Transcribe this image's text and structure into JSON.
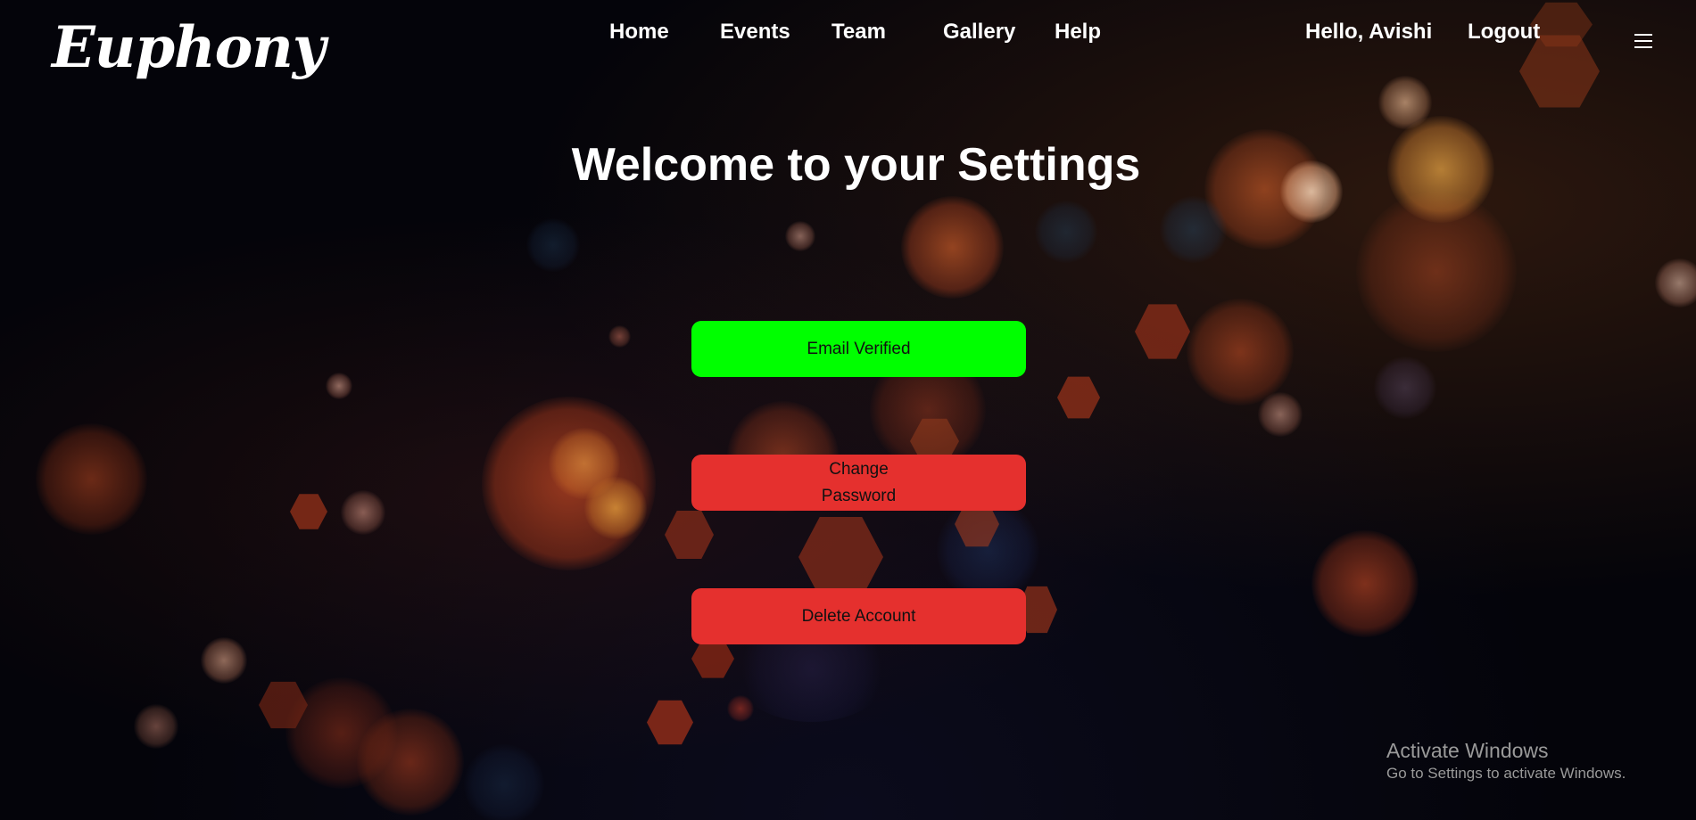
{
  "brand": {
    "logo_text": "Euphony"
  },
  "nav": {
    "links": [
      "Home",
      "Events",
      "Team",
      "Gallery",
      "Help"
    ],
    "greeting": "Hello, Avishi",
    "logout_label": "Logout",
    "menu_icon": "hamburger-menu-icon"
  },
  "main": {
    "title": "Welcome to your Settings",
    "buttons": [
      {
        "label": "Email Verified",
        "color": "#00ff00"
      },
      {
        "label": "Change Password",
        "color": "#e5302e"
      },
      {
        "label": "Delete Account",
        "color": "#e5302e"
      }
    ]
  },
  "watermark": {
    "title": "Activate Windows",
    "subtitle": "Go to Settings to activate Windows."
  },
  "colors": {
    "background": "#04040a",
    "text": "#ffffff",
    "success": "#00ff00",
    "danger": "#e5302e"
  }
}
